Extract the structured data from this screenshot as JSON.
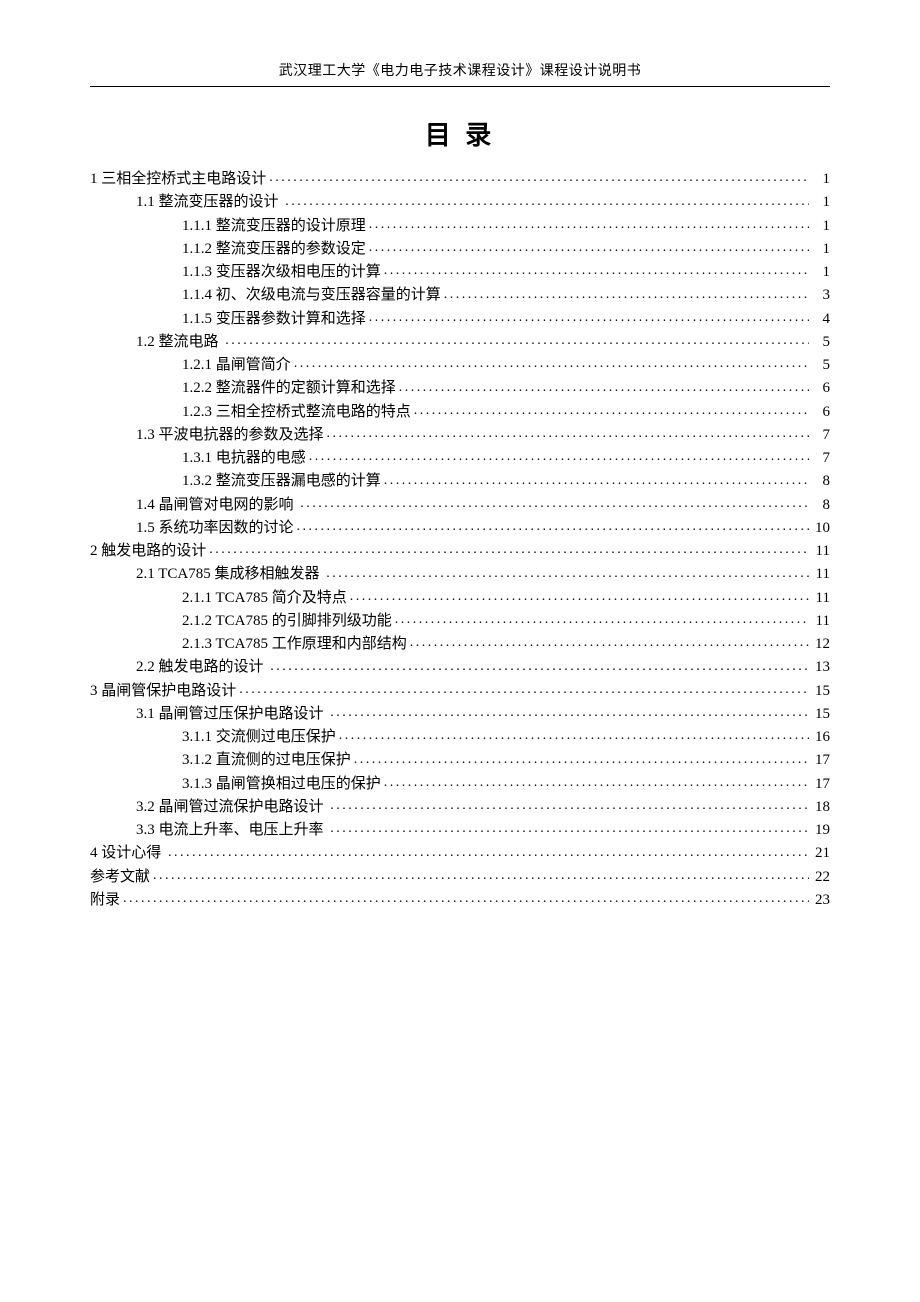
{
  "header": "武汉理工大学《电力电子技术课程设计》课程设计说明书",
  "title": "目 录",
  "toc": [
    {
      "level": 0,
      "label": "1 三相全控桥式主电路设计",
      "page": "1"
    },
    {
      "level": 1,
      "label": "1.1 整流变压器的设计 ",
      "page": "1"
    },
    {
      "level": 2,
      "label": "1.1.1 整流变压器的设计原理",
      "page": "1"
    },
    {
      "level": 2,
      "label": "1.1.2 整流变压器的参数设定",
      "page": "1"
    },
    {
      "level": 2,
      "label": "1.1.3 变压器次级相电压的计算",
      "page": "1"
    },
    {
      "level": 2,
      "label": "1.1.4 初、次级电流与变压器容量的计算",
      "page": "3"
    },
    {
      "level": 2,
      "label": "1.1.5 变压器参数计算和选择",
      "page": "4"
    },
    {
      "level": 1,
      "label": "1.2 整流电路 ",
      "page": "5"
    },
    {
      "level": 2,
      "label": "1.2.1 晶闸管简介",
      "page": "5"
    },
    {
      "level": 2,
      "label": "1.2.2 整流器件的定额计算和选择",
      "page": "6"
    },
    {
      "level": 2,
      "label": "1.2.3 三相全控桥式整流电路的特点",
      "page": "6"
    },
    {
      "level": 1,
      "label": "1.3 平波电抗器的参数及选择",
      "page": "7"
    },
    {
      "level": 2,
      "label": "1.3.1 电抗器的电感",
      "page": "7"
    },
    {
      "level": 2,
      "label": "1.3.2 整流变压器漏电感的计算",
      "page": "8"
    },
    {
      "level": 1,
      "label": "1.4 晶闸管对电网的影响 ",
      "page": "8"
    },
    {
      "level": 1,
      "label": "1.5 系统功率因数的讨论",
      "page": "10"
    },
    {
      "level": 0,
      "label": "2 触发电路的设计",
      "page": "11"
    },
    {
      "level": 1,
      "label": "2.1 TCA785 集成移相触发器 ",
      "page": "11"
    },
    {
      "level": 2,
      "label": "2.1.1 TCA785 简介及特点",
      "page": "11"
    },
    {
      "level": 2,
      "label": "2.1.2 TCA785 的引脚排列级功能",
      "page": "11"
    },
    {
      "level": 2,
      "label": "2.1.3 TCA785 工作原理和内部结构",
      "page": "12"
    },
    {
      "level": 1,
      "label": "2.2 触发电路的设计 ",
      "page": "13"
    },
    {
      "level": 0,
      "label": "3 晶闸管保护电路设计",
      "page": "15"
    },
    {
      "level": 1,
      "label": "3.1 晶闸管过压保护电路设计 ",
      "page": "15"
    },
    {
      "level": 2,
      "label": "3.1.1 交流侧过电压保护",
      "page": "16"
    },
    {
      "level": 2,
      "label": "3.1.2 直流侧的过电压保护",
      "page": "17"
    },
    {
      "level": 2,
      "label": "3.1.3 晶闸管换相过电压的保护",
      "page": "17"
    },
    {
      "level": 1,
      "label": "3.2 晶闸管过流保护电路设计 ",
      "page": "18"
    },
    {
      "level": 1,
      "label": "3.3 电流上升率、电压上升率 ",
      "page": "19"
    },
    {
      "level": 0,
      "label": "4 设计心得 ",
      "page": "21"
    },
    {
      "level": 0,
      "label": "参考文献",
      "page": "22"
    },
    {
      "level": 0,
      "label": "附录",
      "page": "23"
    }
  ]
}
